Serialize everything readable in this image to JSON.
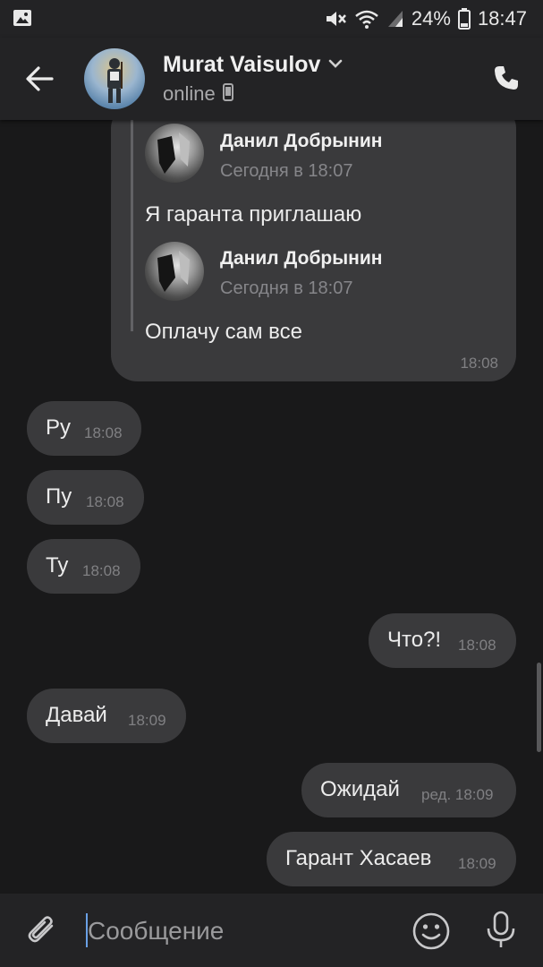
{
  "statusbar": {
    "battery": "24%",
    "time": "18:47"
  },
  "header": {
    "name": "Murat Vaisulov",
    "status": "online"
  },
  "forwarded": [
    {
      "author": "Данил Добрынин",
      "date": "Сегодня в 18:07",
      "text": "Я гаранта приглашаю"
    },
    {
      "author": "Данил Добрынин",
      "date": "Сегодня в 18:07",
      "text": "Оплачу сам все"
    }
  ],
  "forwarded_time": "18:08",
  "messages": [
    {
      "text": "Ру",
      "time": "18:08",
      "side": "left"
    },
    {
      "text": "Пу",
      "time": "18:08",
      "side": "left"
    },
    {
      "text": "Ту",
      "time": "18:08",
      "side": "left"
    },
    {
      "text": "Что?!",
      "time": "18:08",
      "side": "right"
    },
    {
      "text": "Давай",
      "time": "18:09",
      "side": "left"
    },
    {
      "text": "Ожидай",
      "time": "ред. 18:09",
      "side": "right"
    },
    {
      "text": "Гарант Хасаев",
      "time": "18:09",
      "side": "right"
    }
  ],
  "input": {
    "placeholder": "Сообщение"
  },
  "colors": {
    "background": "#19191a",
    "bar": "#232325",
    "bubble": "#3a3a3c",
    "caret": "#6aa0e6"
  }
}
